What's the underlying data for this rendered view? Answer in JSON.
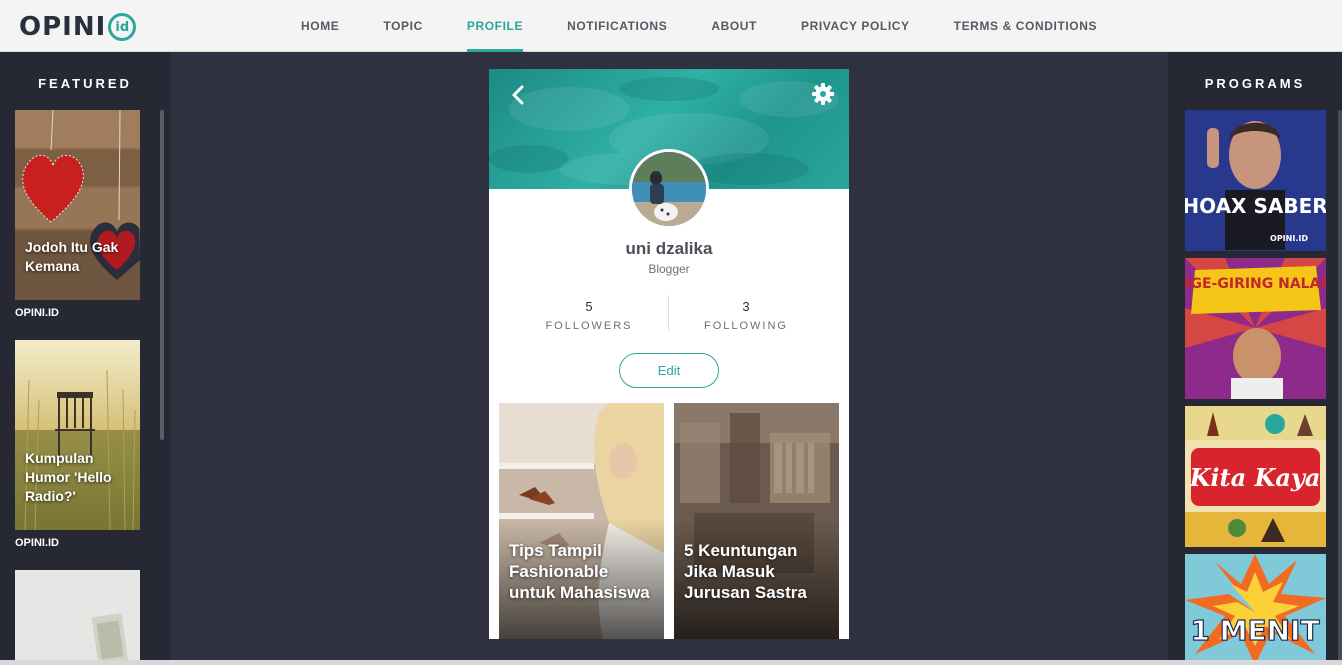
{
  "logo": {
    "text": "OPINI",
    "badge": "id"
  },
  "nav": [
    {
      "label": "HOME",
      "active": false
    },
    {
      "label": "TOPIC",
      "active": false
    },
    {
      "label": "PROFILE",
      "active": true
    },
    {
      "label": "NOTIFICATIONS",
      "active": false
    },
    {
      "label": "ABOUT",
      "active": false
    },
    {
      "label": "PRIVACY POLICY",
      "active": false
    },
    {
      "label": "TERMS & CONDITIONS",
      "active": false
    }
  ],
  "featured": {
    "title": "FEATURED",
    "items": [
      {
        "title": "Jodoh Itu Gak Kemana",
        "source": "OPINI.ID"
      },
      {
        "title": "Kumpulan Humor 'Hello Radio?'",
        "source": "OPINI.ID"
      }
    ]
  },
  "programs": {
    "title": "PROGRAMS",
    "items": [
      {
        "title": "HOAX SABER",
        "sub": "OPINI.ID"
      },
      {
        "title": "NGE-GIRING NALAR"
      },
      {
        "title": "Kita Kaya"
      },
      {
        "title": "1 MENIT"
      }
    ]
  },
  "profile": {
    "name": "uni dzalika",
    "role": "Blogger",
    "followers_count": "5",
    "followers_label": "FOLLOWERS",
    "following_count": "3",
    "following_label": "FOLLOWING",
    "edit_label": "Edit",
    "posts": [
      {
        "title": "Tips Tampil Fashionable untuk Mahasiswa"
      },
      {
        "title": "5 Keuntungan Jika Masuk Jurusan Sastra"
      }
    ]
  },
  "colors": {
    "accent": "#2aa79b",
    "page_bg": "#2f3140",
    "panel_bg": "#262834"
  }
}
